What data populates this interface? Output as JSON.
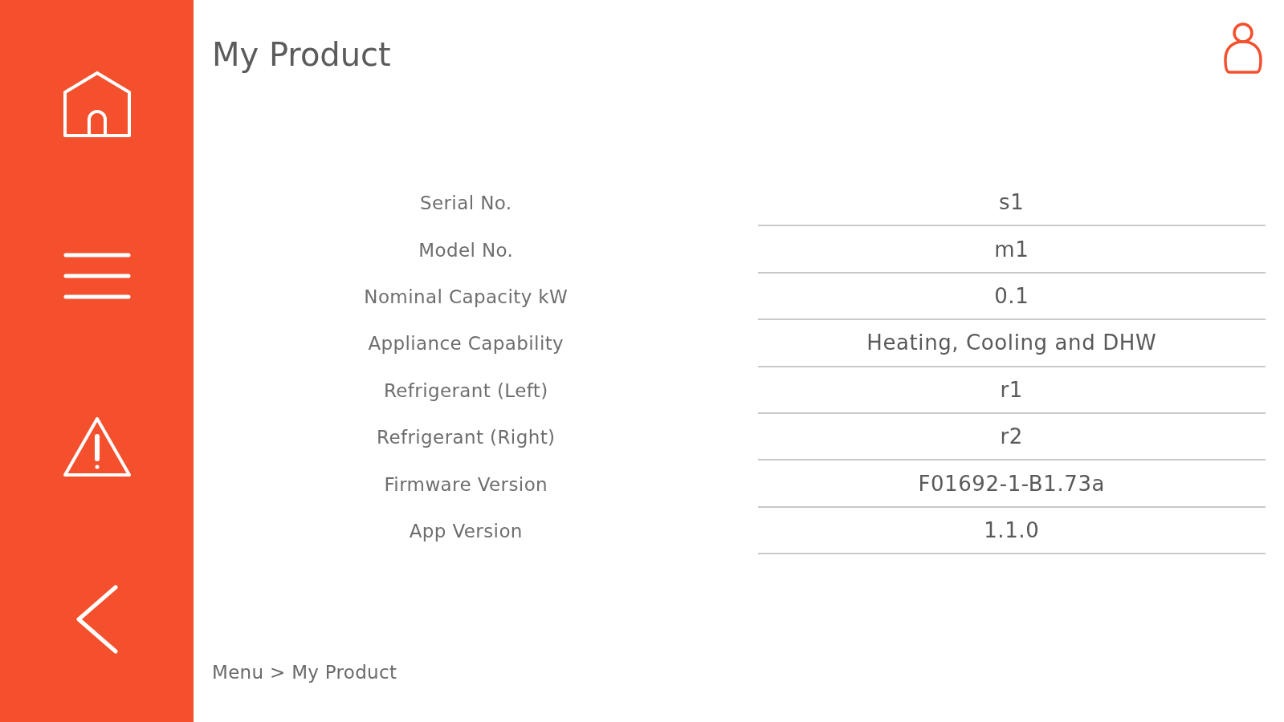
{
  "header": {
    "title": "My Product"
  },
  "product_info": {
    "rows": [
      {
        "label": "Serial No.",
        "value": "s1"
      },
      {
        "label": "Model No.",
        "value": "m1"
      },
      {
        "label": "Nominal Capacity kW",
        "value": "0.1"
      },
      {
        "label": "Appliance Capability",
        "value": "Heating, Cooling and DHW"
      },
      {
        "label": "Refrigerant (Left)",
        "value": "r1"
      },
      {
        "label": "Refrigerant (Right)",
        "value": "r2"
      },
      {
        "label": "Firmware Version",
        "value": "F01692-1-B1.73a"
      },
      {
        "label": "App Version",
        "value": "1.1.0"
      }
    ]
  },
  "breadcrumb": "Menu > My Product"
}
